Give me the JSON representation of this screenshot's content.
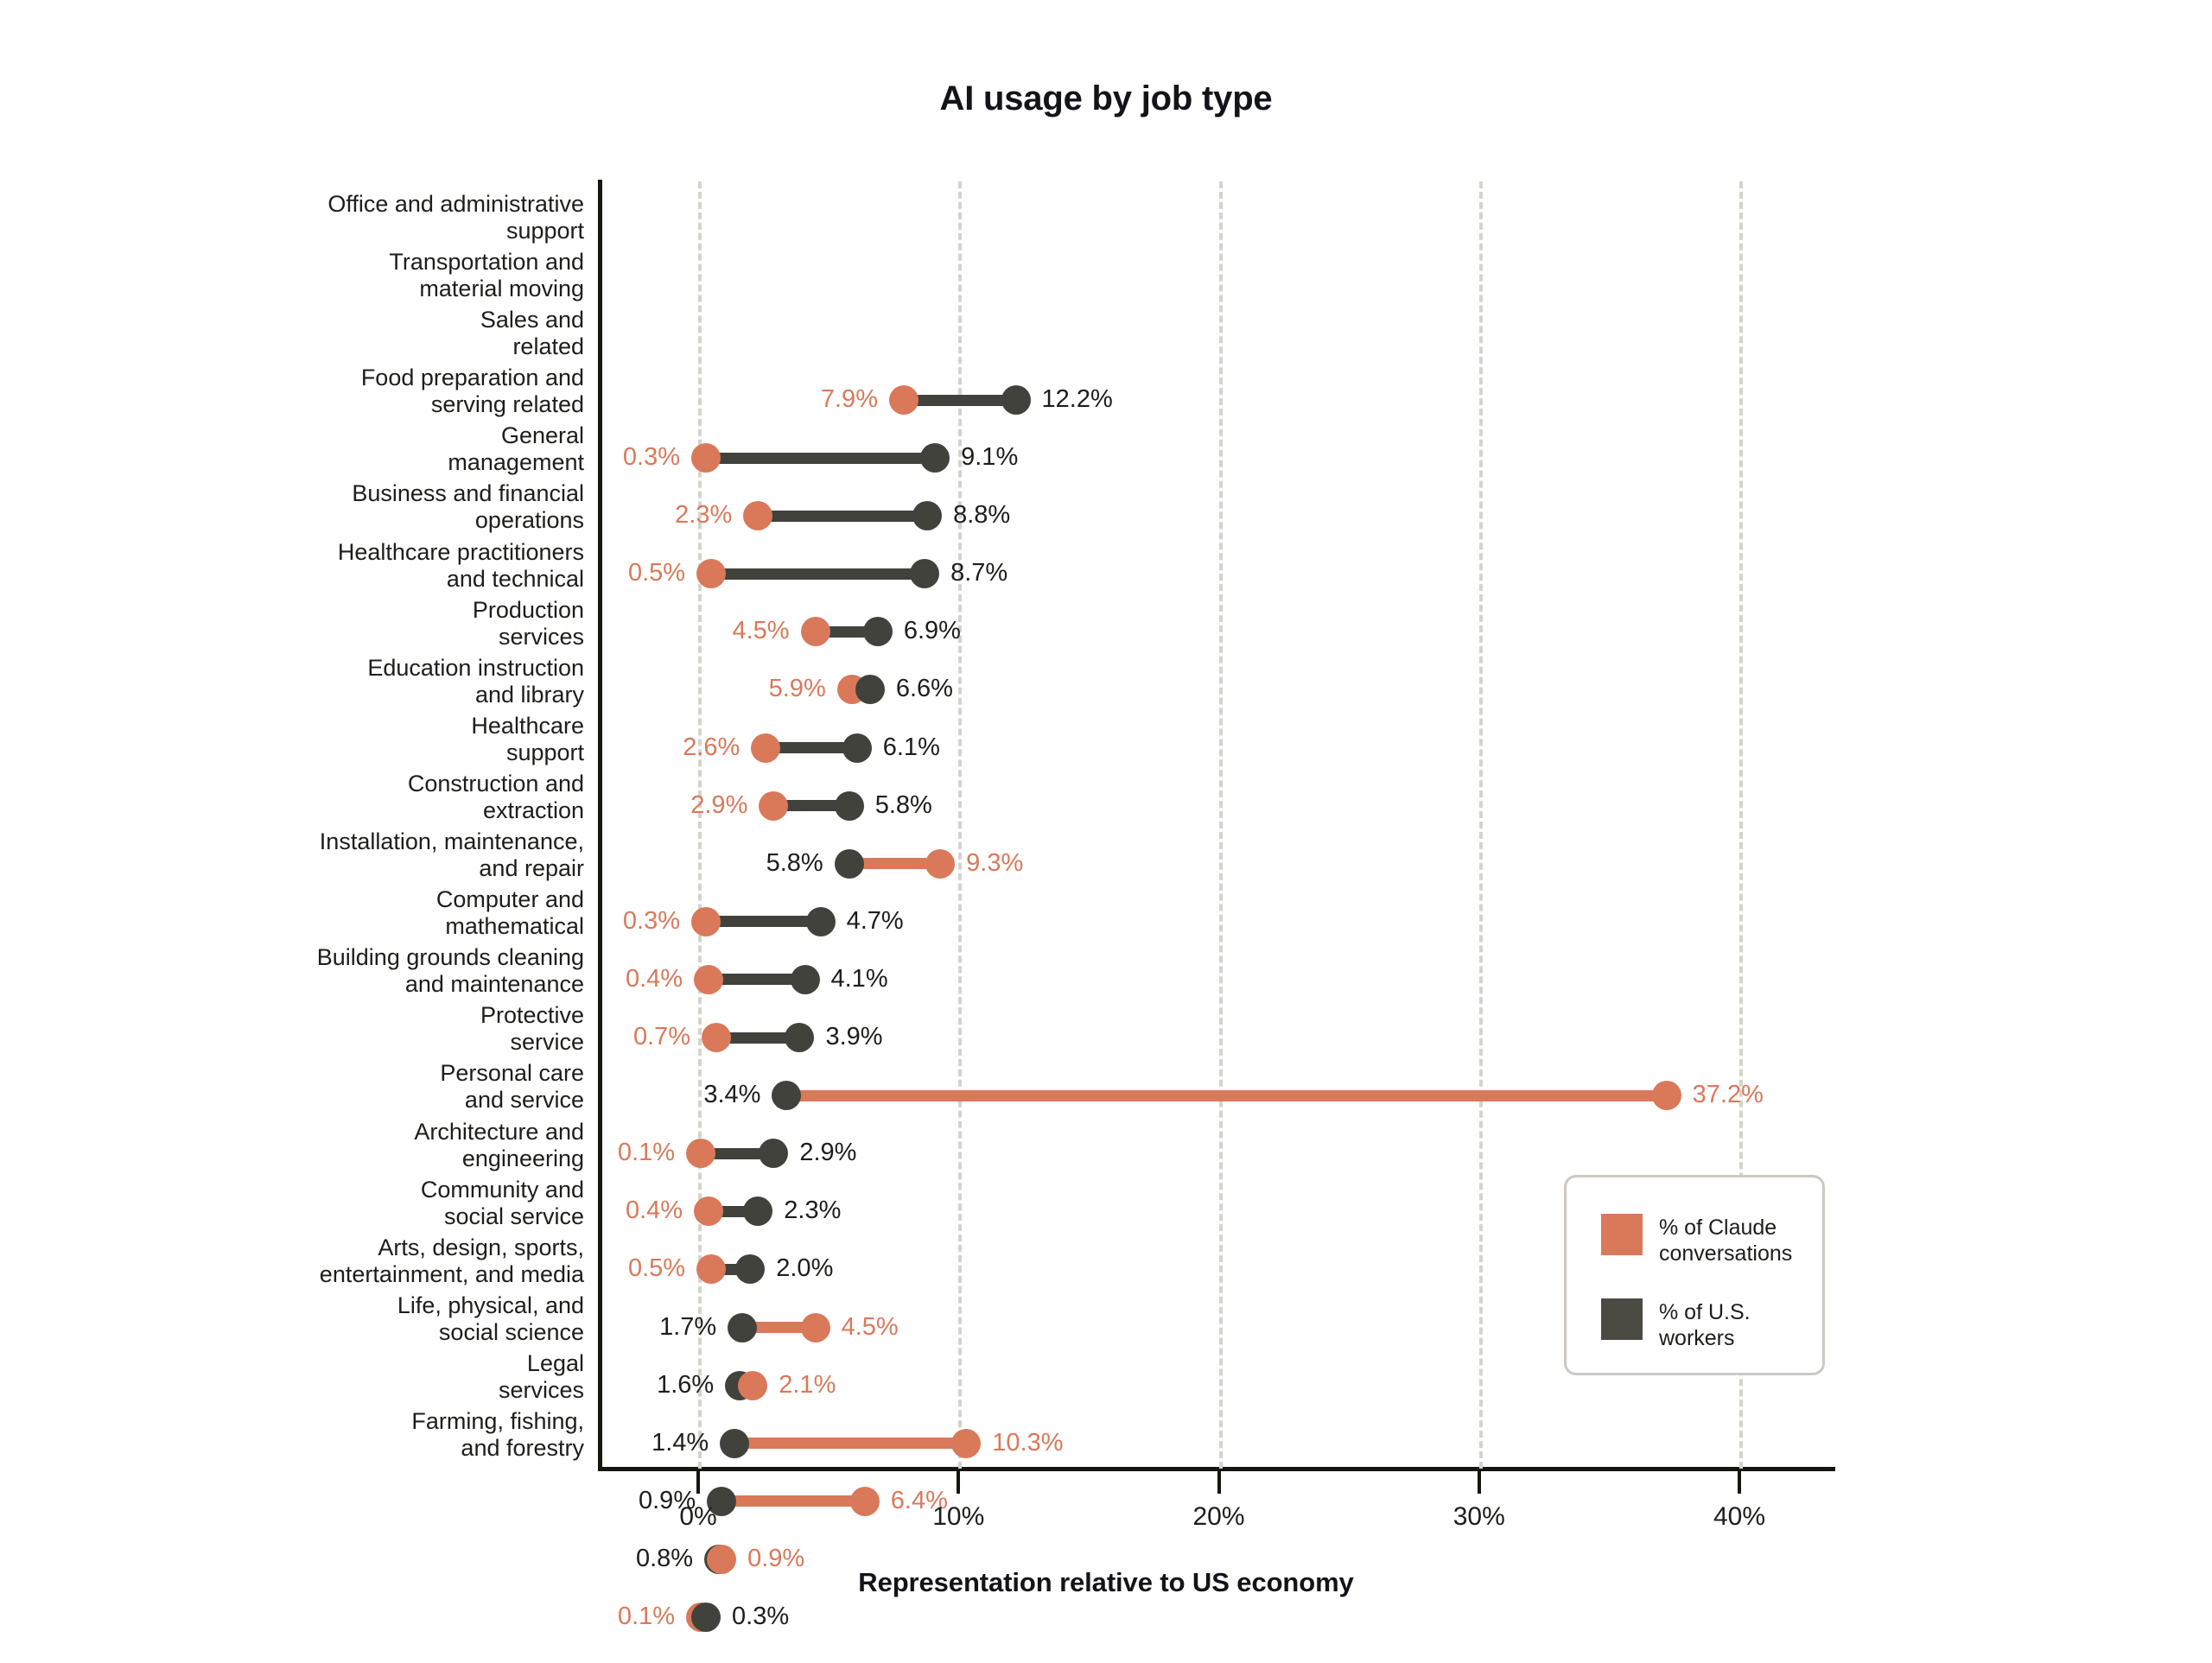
{
  "chart_data": {
    "type": "scatter",
    "subtype": "dumbbell",
    "title": "AI usage by job type",
    "xlabel": "Representation relative to US economy",
    "ylabel": "",
    "xlim": [
      0,
      40
    ],
    "xticks": [
      0,
      10,
      20,
      30,
      40
    ],
    "xtick_labels": [
      "0%",
      "10%",
      "20%",
      "30%",
      "40%"
    ],
    "grid": true,
    "grid_axis": "x",
    "legend_position": "bottom-right",
    "colors": {
      "claude": "#d9795a",
      "workers": "#42423c",
      "grid": "#d6d3cd",
      "axis": "#16160f",
      "text": "#1d1d1b",
      "legend_border": "#cdc9c2",
      "background": "#ffffff"
    },
    "series": [
      {
        "name": "% of Claude conversations",
        "color": "#d9795a"
      },
      {
        "name": "% of U.S. workers",
        "color": "#42423c"
      }
    ],
    "categories": [
      "Office and administrative\nsupport",
      "Transportation and\nmaterial moving",
      "Sales and\nrelated",
      "Food preparation and\nserving related",
      "General\nmanagement",
      "Business and financial\noperations",
      "Healthcare practitioners\nand technical",
      "Production\nservices",
      "Education instruction\nand library",
      "Healthcare\nsupport",
      "Construction and\nextraction",
      "Installation, maintenance,\nand repair",
      "Computer and\nmathematical",
      "Building grounds cleaning\nand maintenance",
      "Protective\nservice",
      "Personal care\nand service",
      "Architecture and\nengineering",
      "Community and\nsocial service",
      "Arts, design, sports,\nentertainment, and media",
      "Life, physical, and\nsocial science",
      "Legal\nservices",
      "Farming, fishing,\nand forestry"
    ],
    "rows": [
      {
        "category": "Office and administrative support",
        "claude": 7.9,
        "workers": 12.2,
        "claude_label": "7.9%",
        "workers_label": "12.2%"
      },
      {
        "category": "Transportation and material moving",
        "claude": 0.3,
        "workers": 9.1,
        "claude_label": "0.3%",
        "workers_label": "9.1%"
      },
      {
        "category": "Sales and related",
        "claude": 2.3,
        "workers": 8.8,
        "claude_label": "2.3%",
        "workers_label": "8.8%"
      },
      {
        "category": "Food preparation and serving related",
        "claude": 0.5,
        "workers": 8.7,
        "claude_label": "0.5%",
        "workers_label": "8.7%"
      },
      {
        "category": "General management",
        "claude": 4.5,
        "workers": 6.9,
        "claude_label": "4.5%",
        "workers_label": "6.9%"
      },
      {
        "category": "Business and financial operations",
        "claude": 5.9,
        "workers": 6.6,
        "claude_label": "5.9%",
        "workers_label": "6.6%"
      },
      {
        "category": "Healthcare practitioners and technical",
        "claude": 2.6,
        "workers": 6.1,
        "claude_label": "2.6%",
        "workers_label": "6.1%"
      },
      {
        "category": "Production services",
        "claude": 2.9,
        "workers": 5.8,
        "claude_label": "2.9%",
        "workers_label": "5.8%"
      },
      {
        "category": "Education instruction and library",
        "claude": 9.3,
        "workers": 5.8,
        "claude_label": "9.3%",
        "workers_label": "5.8%"
      },
      {
        "category": "Healthcare support",
        "claude": 0.3,
        "workers": 4.7,
        "claude_label": "0.3%",
        "workers_label": "4.7%"
      },
      {
        "category": "Construction and extraction",
        "claude": 0.4,
        "workers": 4.1,
        "claude_label": "0.4%",
        "workers_label": "4.1%"
      },
      {
        "category": "Installation, maintenance, and repair",
        "claude": 0.7,
        "workers": 3.9,
        "claude_label": "0.7%",
        "workers_label": "3.9%"
      },
      {
        "category": "Computer and mathematical",
        "claude": 37.2,
        "workers": 3.4,
        "claude_label": "37.2%",
        "workers_label": "3.4%"
      },
      {
        "category": "Building grounds cleaning and maintenance",
        "claude": 0.1,
        "workers": 2.9,
        "claude_label": "0.1%",
        "workers_label": "2.9%"
      },
      {
        "category": "Protective service",
        "claude": 0.4,
        "workers": 2.3,
        "claude_label": "0.4%",
        "workers_label": "2.3%"
      },
      {
        "category": "Personal care and service",
        "claude": 0.5,
        "workers": 2.0,
        "claude_label": "0.5%",
        "workers_label": "2.0%"
      },
      {
        "category": "Architecture and engineering",
        "claude": 4.5,
        "workers": 1.7,
        "claude_label": "4.5%",
        "workers_label": "1.7%"
      },
      {
        "category": "Community and social service",
        "claude": 2.1,
        "workers": 1.6,
        "claude_label": "2.1%",
        "workers_label": "1.6%"
      },
      {
        "category": "Arts, design, sports, entertainment, and media",
        "claude": 10.3,
        "workers": 1.4,
        "claude_label": "10.3%",
        "workers_label": "1.4%"
      },
      {
        "category": "Life, physical, and social science",
        "claude": 6.4,
        "workers": 0.9,
        "claude_label": "6.4%",
        "workers_label": "0.9%"
      },
      {
        "category": "Legal services",
        "claude": 0.9,
        "workers": 0.8,
        "claude_label": "0.9%",
        "workers_label": "0.8%"
      },
      {
        "category": "Farming, fishing, and forestry",
        "claude": 0.1,
        "workers": 0.3,
        "claude_label": "0.1%",
        "workers_label": "0.3%"
      }
    ]
  },
  "legend": {
    "items": [
      {
        "label": "% of Claude\nconversations",
        "color": "#d9795a",
        "key": "claude"
      },
      {
        "label": "% of U.S.\nworkers",
        "color": "#4b4b44",
        "key": "workers"
      }
    ]
  }
}
